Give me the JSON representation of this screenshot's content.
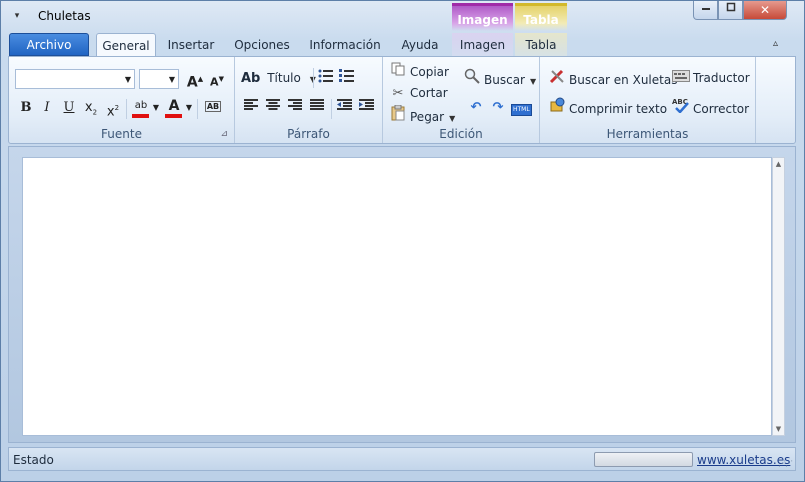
{
  "window": {
    "title": "Chuletas",
    "qat_menu_icon": "chevron-down-icon",
    "controls": {
      "minimize": "▭",
      "maximize": "▢",
      "close": "✕"
    }
  },
  "context_tabs": {
    "imagen_header": "Imagen",
    "tabla_header": "Tabla"
  },
  "tabs": {
    "file": "Archivo",
    "items": [
      "General",
      "Insertar",
      "Opciones",
      "Información",
      "Ayuda",
      "Imagen",
      "Tabla"
    ],
    "active": "General"
  },
  "ribbon": {
    "fuente": {
      "label": "Fuente",
      "font_name_value": "",
      "font_size_value": "",
      "grow_font": "A",
      "shrink_font": "A",
      "bold": "B",
      "italic": "I",
      "underline": "U",
      "subscript": "x",
      "superscript": "x",
      "highlight": "ab",
      "font_color": "A",
      "clear_format": "AB"
    },
    "parrafo": {
      "label": "Párrafo",
      "style_name": "Título",
      "style_icon_text": "Ab"
    },
    "edicion": {
      "label": "Edición",
      "copy": "Copiar",
      "cut": "Cortar",
      "paste": "Pegar",
      "find": "Buscar",
      "html_badge": "HTML"
    },
    "herramientas": {
      "label": "Herramientas",
      "search_xuletas": "Buscar en Xuletas",
      "compress": "Comprimir texto",
      "translator": "Traductor",
      "spellcheck": "Corrector"
    }
  },
  "editor": {
    "content": ""
  },
  "statusbar": {
    "status": "Estado",
    "progress": 0,
    "link": "www.xuletas.es"
  },
  "colors": {
    "archivo_tab": "#2064c3",
    "ctx_imagen": "#a02ba8",
    "ctx_tabla": "#d2b92c",
    "highlight_bar": "#f0e020",
    "font_color_bar": "#e01010",
    "close_button": "#c74a39"
  }
}
